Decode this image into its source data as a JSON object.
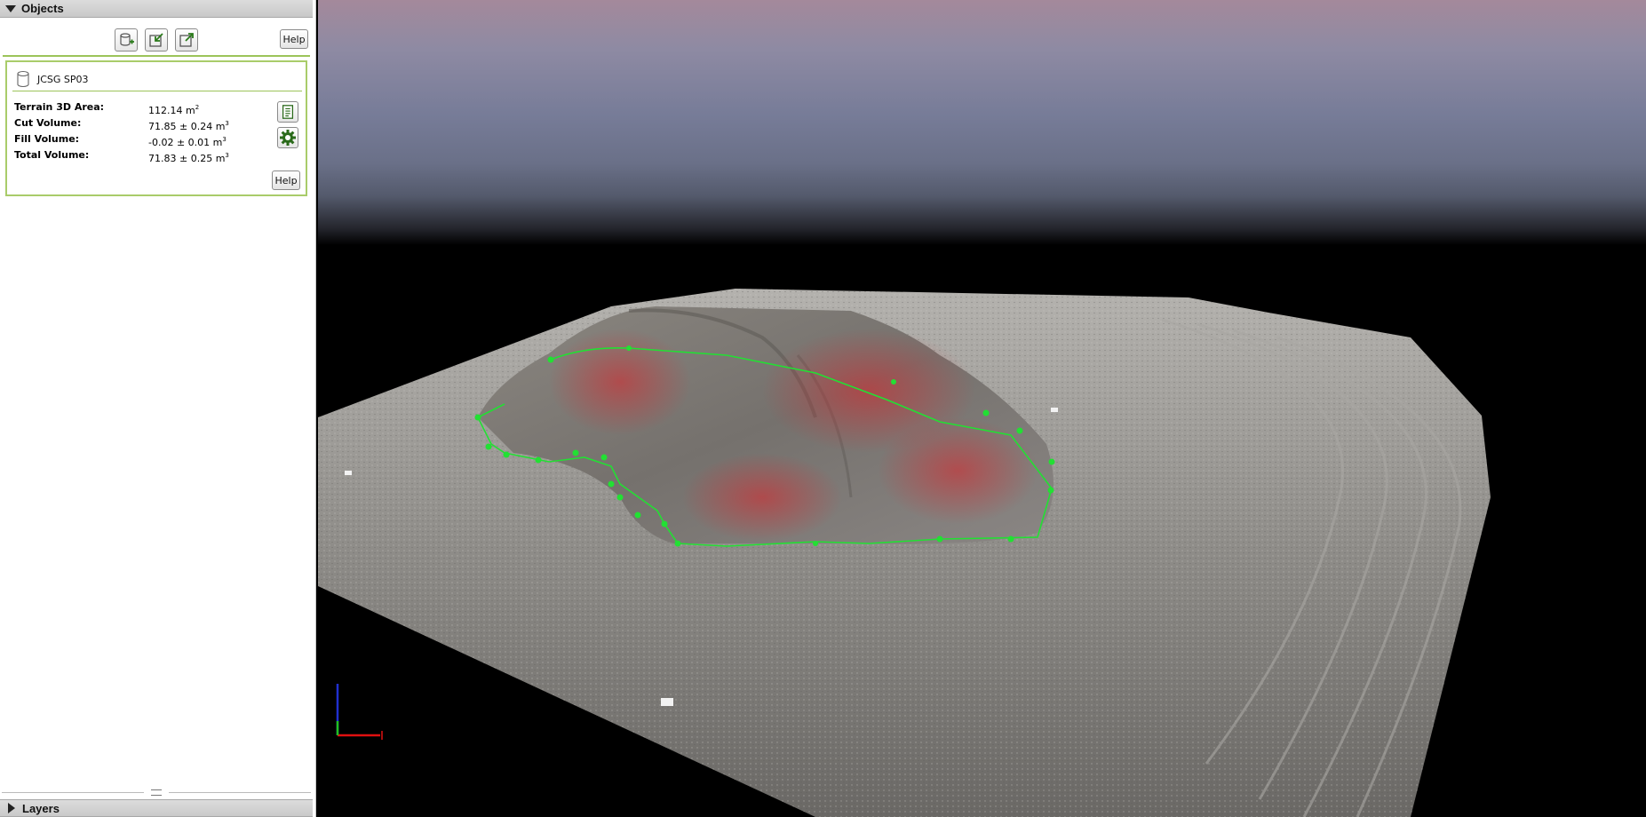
{
  "objects_panel": {
    "header_label": "Objects",
    "toolbar": {
      "help_label": "Help",
      "buttons": [
        "new-volume-icon",
        "import-icon",
        "export-icon"
      ]
    },
    "volume": {
      "name": "JCSG SP03",
      "measurements": [
        {
          "label": "Terrain 3D Area:",
          "value": "112.14  m",
          "unit_sup": "2"
        },
        {
          "label": "Cut Volume:",
          "value": "71.85  ± 0.24  m",
          "unit_sup": "3"
        },
        {
          "label": "Fill Volume:",
          "value": "-0.02  ± 0.01  m",
          "unit_sup": "3"
        },
        {
          "label": "Total Volume:",
          "value": "71.83  ± 0.25  m",
          "unit_sup": "3"
        }
      ],
      "help_label": "Help"
    }
  },
  "layers_panel": {
    "header_label": "Layers"
  },
  "colors": {
    "accent_green": "#9cc45a",
    "boundary_green": "#22e033",
    "cut_red": "#d8262c",
    "axis_x": "#e01010",
    "axis_z": "#2030d0"
  }
}
